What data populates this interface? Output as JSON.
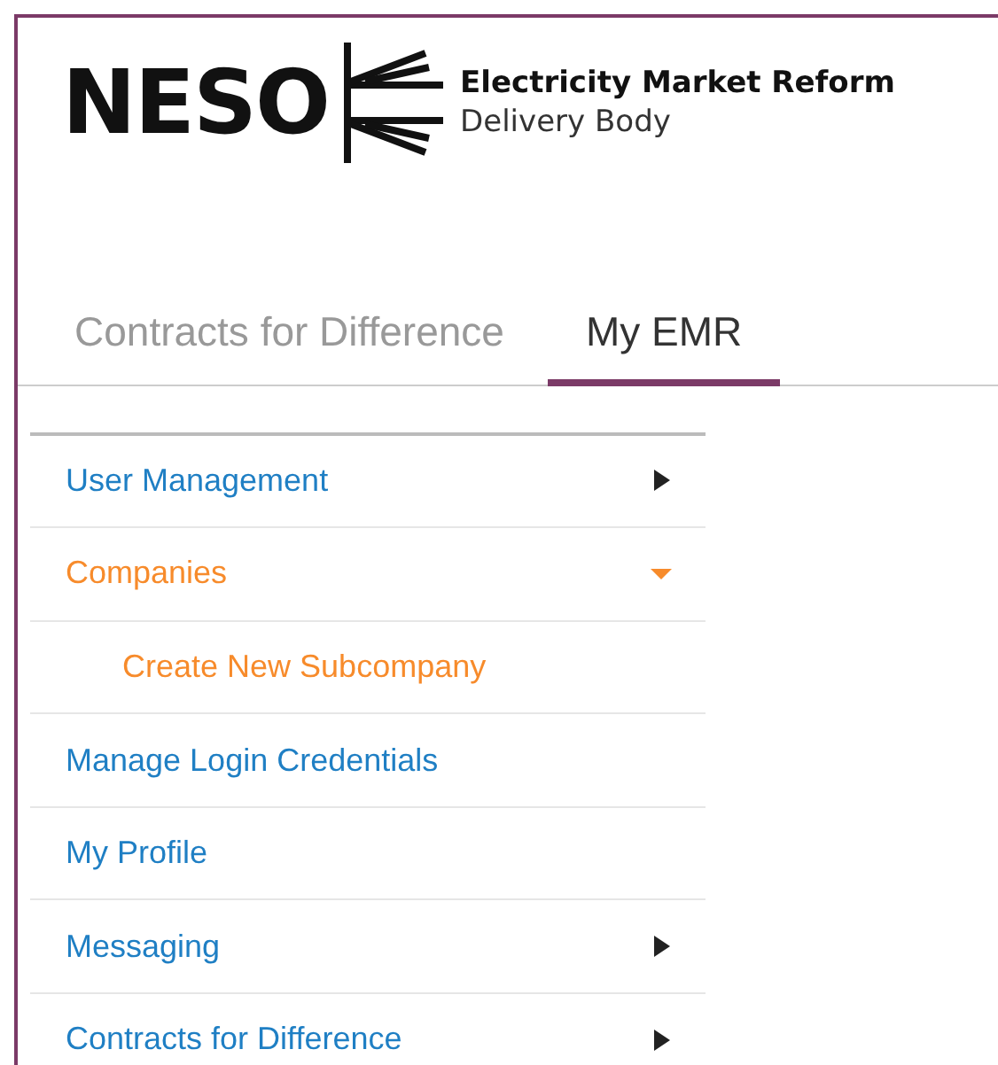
{
  "logo": {
    "wordmark": "NESO",
    "line_1": "Electricity Market Reform",
    "line_2": "Delivery Body"
  },
  "tabs": [
    {
      "label": "Contracts for Difference",
      "selected": false
    },
    {
      "label": "My EMR",
      "selected": true
    }
  ],
  "menu": [
    {
      "label": "User Management",
      "selected": false,
      "expanded": false
    },
    {
      "label": "Companies",
      "selected": true,
      "expanded": true,
      "children": [
        {
          "label": "Create New Subcompany",
          "selected": true
        }
      ]
    },
    {
      "label": "Manage Login Credentials",
      "selected": false
    },
    {
      "label": "My Profile",
      "selected": false
    },
    {
      "label": "Messaging",
      "selected": false,
      "expanded": false
    },
    {
      "label": "Contracts for Difference",
      "selected": false,
      "expanded": false
    }
  ]
}
